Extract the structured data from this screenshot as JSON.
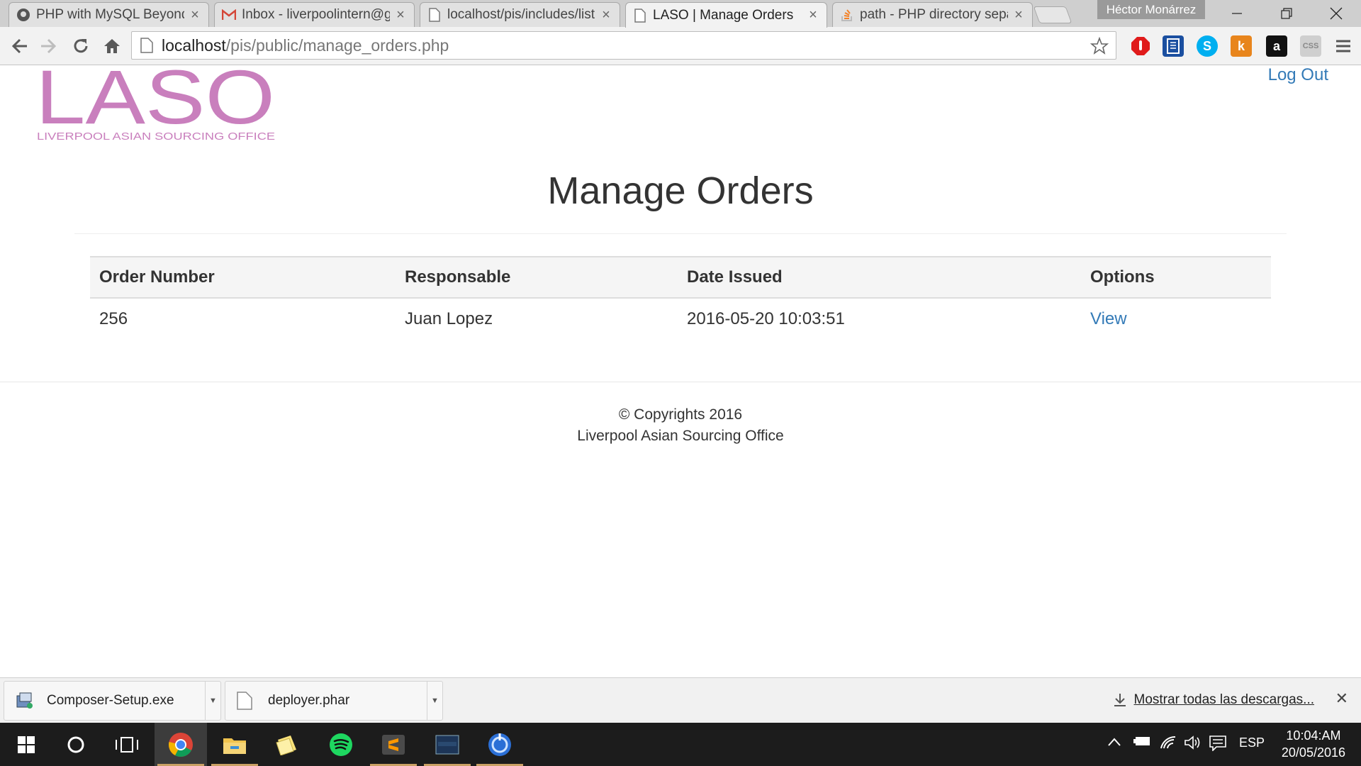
{
  "browser": {
    "tabs": [
      {
        "title": "PHP with MySQL Beyond t",
        "icon": "lynda-icon",
        "active": false
      },
      {
        "title": "Inbox - liverpoolintern@g",
        "icon": "gmail-icon",
        "active": false
      },
      {
        "title": "localhost/pis/includes/list",
        "icon": "page-icon",
        "active": false
      },
      {
        "title": "LASO | Manage Orders",
        "icon": "page-icon",
        "active": true
      },
      {
        "title": "path - PHP directory separ",
        "icon": "stackoverflow-icon",
        "active": false
      }
    ],
    "user": "Héctor Monárrez",
    "url_host": "localhost",
    "url_path": "/pis/public/manage_orders.php"
  },
  "header": {
    "logo_text": "LASO",
    "logo_subtitle": "LIVERPOOL ASIAN SOURCING OFFICE",
    "logout_label": "Log Out"
  },
  "main": {
    "title": "Manage Orders",
    "columns": [
      "Order Number",
      "Responsable",
      "Date Issued",
      "Options"
    ],
    "rows": [
      {
        "order_number": "256",
        "responsable": "Juan Lopez",
        "date_issued": "2016-05-20 10:03:51",
        "option_label": "View"
      }
    ]
  },
  "footer": {
    "line1": "© Copyrights 2016",
    "line2": "Liverpool Asian Sourcing Office"
  },
  "downloads": {
    "items": [
      "Composer-Setup.exe",
      "deployer.phar"
    ],
    "show_all_label": "Mostrar todas las descargas..."
  },
  "taskbar": {
    "language": "ESP",
    "time": "10:04:AM",
    "date": "20/05/2016"
  },
  "colors": {
    "link": "#337ab7",
    "logo": "#c97fbd"
  }
}
